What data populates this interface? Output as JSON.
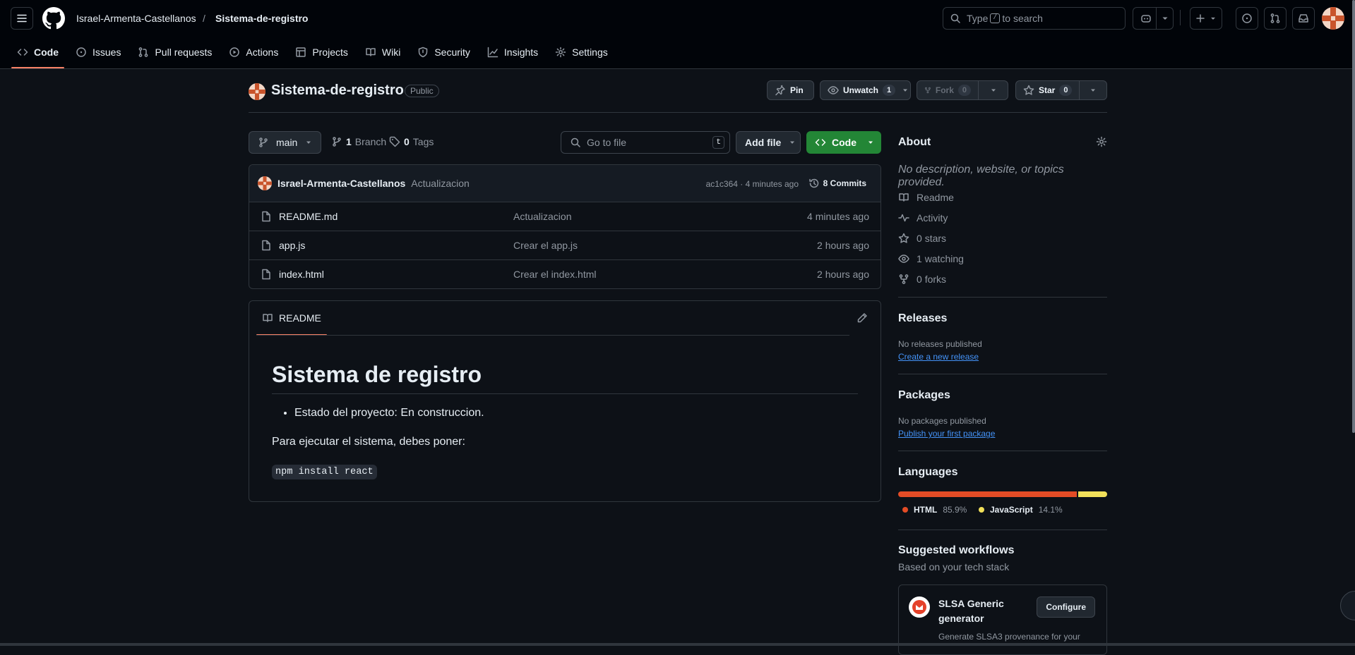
{
  "header": {
    "owner": "Israel-Armenta-Castellanos",
    "separator": "/",
    "repo": "Sistema-de-registro",
    "search_prefix": "Type",
    "search_key": "/",
    "search_suffix": "to search"
  },
  "tabs": [
    {
      "label": "Code",
      "icon": "code-icon",
      "active": true
    },
    {
      "label": "Issues",
      "icon": "issue-icon"
    },
    {
      "label": "Pull requests",
      "icon": "pull-request-icon"
    },
    {
      "label": "Actions",
      "icon": "play-icon"
    },
    {
      "label": "Projects",
      "icon": "table-icon"
    },
    {
      "label": "Wiki",
      "icon": "book-icon"
    },
    {
      "label": "Security",
      "icon": "shield-icon"
    },
    {
      "label": "Insights",
      "icon": "graph-icon"
    },
    {
      "label": "Settings",
      "icon": "gear-icon"
    }
  ],
  "repo_head": {
    "name": "Sistema-de-registro",
    "visibility": "Public",
    "pin_label": "Pin",
    "unwatch_label": "Unwatch",
    "watch_count": "1",
    "fork_label": "Fork",
    "fork_count": "0",
    "star_label": "Star",
    "star_count": "0"
  },
  "file_nav": {
    "branch": "main",
    "branch_count": "1",
    "branch_label": "Branch",
    "tag_count": "0",
    "tag_label": "Tags",
    "goto_placeholder": "Go to file",
    "goto_key": "t",
    "add_file": "Add file",
    "code_label": "Code"
  },
  "latest_commit": {
    "author": "Israel-Armenta-Castellanos",
    "message": "Actualizacion",
    "sha_time": "ac1c364 · 4 minutes ago",
    "commits_label": "8 Commits"
  },
  "files": [
    {
      "name": "README.md",
      "message": "Actualizacion",
      "age": "4 minutes ago"
    },
    {
      "name": "app.js",
      "message": "Crear el app.js",
      "age": "2 hours ago"
    },
    {
      "name": "index.html",
      "message": "Crear el index.html",
      "age": "2 hours ago"
    }
  ],
  "readme": {
    "tab_label": "README",
    "title": "Sistema de registro",
    "bullet": "Estado del proyecto: En construccion.",
    "paragraph": "Para ejecutar el sistema, debes poner:",
    "code": "npm install react"
  },
  "about": {
    "title": "About",
    "description": "No description, website, or topics provided.",
    "items": [
      {
        "icon": "book-icon",
        "label": "Readme"
      },
      {
        "icon": "pulse-icon",
        "label": "Activity"
      },
      {
        "icon": "star-icon",
        "count": "0",
        "label": "stars"
      },
      {
        "icon": "eye-icon",
        "count": "1",
        "label": "watching"
      },
      {
        "icon": "fork-icon",
        "count": "0",
        "label": "forks"
      }
    ]
  },
  "releases": {
    "title": "Releases",
    "empty": "No releases published",
    "link": "Create a new release"
  },
  "packages": {
    "title": "Packages",
    "empty": "No packages published",
    "link": "Publish your first package"
  },
  "languages": {
    "title": "Languages",
    "items": [
      {
        "name": "HTML",
        "percent": "85.9%",
        "value": 85.9,
        "color": "#e34c26"
      },
      {
        "name": "JavaScript",
        "percent": "14.1%",
        "value": 14.1,
        "color": "#f1e05a"
      }
    ]
  },
  "workflows": {
    "title": "Suggested workflows",
    "subtitle": "Based on your tech stack",
    "card_name": "SLSA Generic generator",
    "card_button": "Configure",
    "card_desc": "Generate SLSA3 provenance for your"
  },
  "colors": {
    "accent_green": "#238636",
    "tab_underline": "#f78166",
    "link_blue": "#4493f8"
  }
}
